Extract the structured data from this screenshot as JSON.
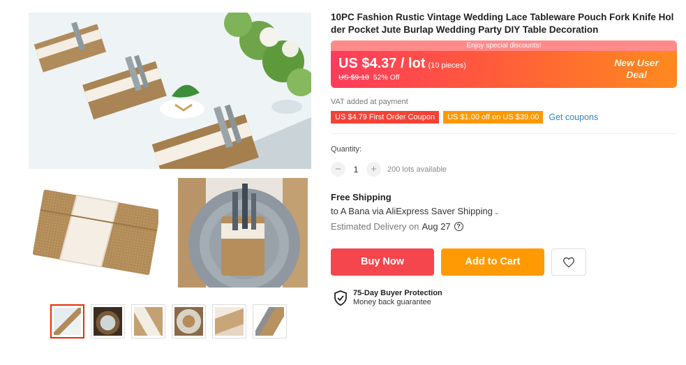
{
  "product": {
    "title": "10PC Fashion Rustic Vintage Wedding Lace Tableware Pouch Fork Knife Holder Pocket Jute Burlap Wedding Party DIY Table Decoration"
  },
  "gallery": {
    "main_image": "burlap-lace-cutlery-holders-on-wedding-table",
    "sub_images": [
      "burlap-lace-pouch-flat",
      "burlap-pouch-with-fork-knife-on-gray-plate"
    ],
    "thumbnails": [
      {
        "name": "table-setting",
        "active": true
      },
      {
        "name": "round-table",
        "active": false
      },
      {
        "name": "lace-runner",
        "active": false
      },
      {
        "name": "pouch-on-plate",
        "active": false
      },
      {
        "name": "pouch-tag",
        "active": false
      },
      {
        "name": "pouch-with-cutlery",
        "active": false
      }
    ]
  },
  "price": {
    "promo_text": "Enjoy special discounts!",
    "current": "US $4.37 / lot",
    "unit_note": "(10 pieces)",
    "original": "US $9.10",
    "discount": "52% Off",
    "badge_line1": "New User",
    "badge_line2": "Deal"
  },
  "vat_note": "VAT added at payment",
  "coupons": {
    "first_order": "US $4.79 First Order Coupon",
    "store": "US $1.00 off on US $39.00",
    "get_link": "Get coupons"
  },
  "quantity": {
    "label": "Quantity:",
    "minus": "−",
    "plus": "+",
    "value": "1",
    "available": "200 lots available"
  },
  "shipping": {
    "title": "Free Shipping",
    "method": "to A Bana via AliExpress Saver Shipping",
    "delivery_label": "Estimated Delivery on",
    "delivery_date": "Aug 27"
  },
  "actions": {
    "buy_now": "Buy Now",
    "add_to_cart": "Add to Cart"
  },
  "protection": {
    "title": "75-Day Buyer Protection",
    "subtitle": "Money back guarantee"
  },
  "colors": {
    "price_gradient_start": "#ff3b5c",
    "price_gradient_end": "#ff8a1e",
    "buy_now": "#f4464c",
    "add_to_cart": "#ff9a05",
    "link": "#2f86b8"
  }
}
